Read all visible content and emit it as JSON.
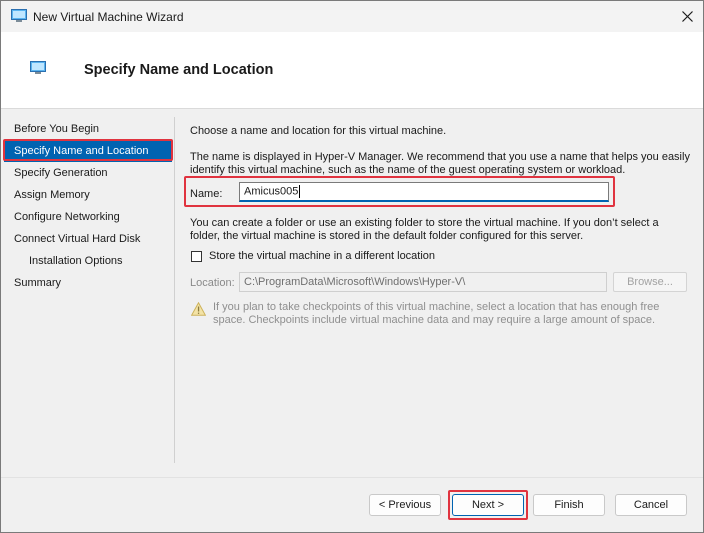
{
  "window": {
    "title": "New Virtual Machine Wizard",
    "close_glyph": "✕"
  },
  "header": {
    "title": "Specify Name and Location"
  },
  "nav": {
    "items": [
      {
        "label": "Before You Begin",
        "selected": false
      },
      {
        "label": "Specify Name and Location",
        "selected": true
      },
      {
        "label": "Specify Generation",
        "selected": false
      },
      {
        "label": "Assign Memory",
        "selected": false
      },
      {
        "label": "Configure Networking",
        "selected": false
      },
      {
        "label": "Connect Virtual Hard Disk",
        "selected": false
      },
      {
        "label": "Installation Options",
        "selected": false
      },
      {
        "label": "Summary",
        "selected": false
      }
    ]
  },
  "content": {
    "intro": "Choose a name and location for this virtual machine.",
    "name_help": "The name is displayed in Hyper-V Manager. We recommend that you use a name that helps you easily identify this virtual machine, such as the name of the guest operating system or workload.",
    "name_label": "Name:",
    "name_value": "Amicus005",
    "folder_help": "You can create a folder or use an existing folder to store the virtual machine. If you don’t select a folder, the virtual machine is stored in the default folder configured for this server.",
    "checkbox_label": "Store the virtual machine in a different location",
    "checkbox_checked": false,
    "location_label": "Location:",
    "location_value": "C:\\ProgramData\\Microsoft\\Windows\\Hyper-V\\",
    "browse_label": "Browse...",
    "warning_text": "If you plan to take checkpoints of this virtual machine, select a location that has enough free space. Checkpoints include virtual machine data and may require a large amount of space."
  },
  "buttons": {
    "previous": "< Previous",
    "next": "Next >",
    "finish": "Finish",
    "cancel": "Cancel"
  },
  "colors": {
    "accent": "#0063b1",
    "highlight": "#e0333f",
    "warning": "#e6b800"
  }
}
